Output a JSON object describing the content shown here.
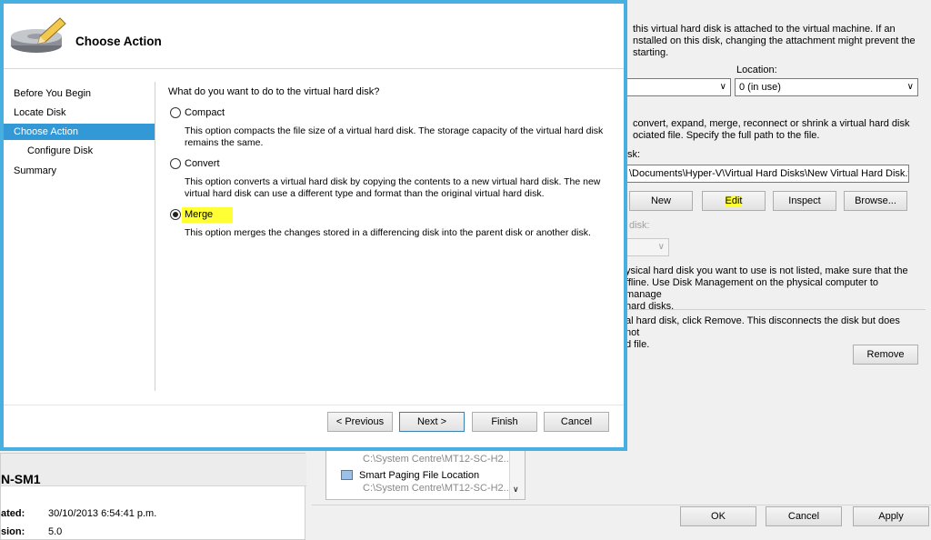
{
  "wizard": {
    "title": "Choose Action",
    "nav": [
      "Before You Begin",
      "Locate Disk",
      "Choose Action",
      "Configure Disk",
      "Summary"
    ],
    "question": "What do you want to do to the virtual hard disk?",
    "options": [
      {
        "label": "Compact",
        "desc1": "This option compacts the file size of a virtual hard disk. The storage capacity of the virtual hard disk",
        "desc2": "remains the same.",
        "selected": false
      },
      {
        "label": "Convert",
        "desc1": "This option converts a virtual hard disk by copying the contents to a new virtual hard disk. The new",
        "desc2": "virtual hard disk can use a different type and format than the original virtual hard disk.",
        "selected": false
      },
      {
        "label": "Merge",
        "desc1": "This option merges the changes stored in a differencing disk into the parent disk or another disk.",
        "desc2": "",
        "selected": true
      }
    ],
    "buttons": {
      "previous": "< Previous",
      "next": "Next >",
      "finish": "Finish",
      "cancel": "Cancel"
    }
  },
  "settings": {
    "text1": [
      "this virtual hard disk is attached to the virtual machine. If an",
      "nstalled on this disk, changing the attachment might prevent the",
      "starting."
    ],
    "location_label": "Location:",
    "location_value": "0 (in use)",
    "text2": [
      "convert, expand, merge, reconnect or shrink a virtual hard disk",
      "ociated file. Specify the full path to the file."
    ],
    "disk_label": "sk:",
    "path_value": "\\Documents\\Hyper-V\\Virtual Hard Disks\\New Virtual Hard Disk.vhd",
    "buttons": {
      "new": "New",
      "edit": "Edit",
      "inspect": "Inspect",
      "browse": "Browse..."
    },
    "physical_label": "disk:",
    "text3": [
      "ysical hard disk you want to use is not listed, make sure that the",
      "ffline. Use Disk Management on the physical computer to manage",
      "hard disks."
    ],
    "text4": [
      "al hard disk, click Remove. This disconnects the disk but does not",
      "d file."
    ],
    "remove": "Remove",
    "footer": {
      "ok": "OK",
      "cancel": "Cancel",
      "apply": "Apply"
    }
  },
  "tree": {
    "path1": "C:\\System Centre\\MT12-SC-H2...",
    "item": "Smart Paging File Location",
    "path2": "C:\\System Centre\\MT12-SC-H2..."
  },
  "vm_details": {
    "name": "N-SM1",
    "created_label": "ated:",
    "created_value": "30/10/2013 6:54:41 p.m.",
    "version_label": "sion:",
    "version_value": "5.0"
  },
  "colors": {
    "accent": "#3399d6",
    "border": "#47b0e0",
    "highlight": "#ffff33"
  }
}
